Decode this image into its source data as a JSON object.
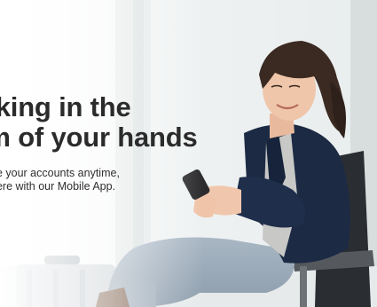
{
  "banner": {
    "headline_line1": "nking in the",
    "headline_line2": "lm of your hands",
    "subtext_line1": "ge your accounts anytime,",
    "subtext_line2": "here with our Mobile App."
  },
  "colors": {
    "background": "#f4f5f5",
    "headline_text": "#2b2b2b",
    "body_text": "#2f2f2f",
    "blazer": "#1c2a44"
  }
}
